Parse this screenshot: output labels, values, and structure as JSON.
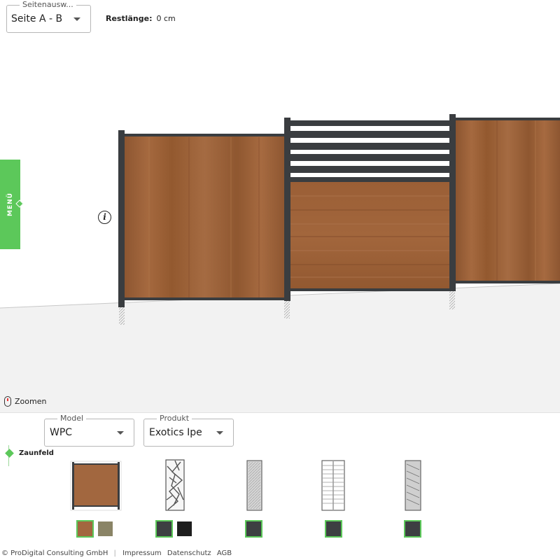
{
  "top": {
    "side_select": {
      "legend": "Seitenausw...",
      "value": "Seite A - B"
    },
    "rest_label": "Restlänge:",
    "rest_value": "0 cm"
  },
  "side_menu": {
    "label": "MENÜ"
  },
  "zoom_label": "Zoomen",
  "panel": {
    "model_select": {
      "legend": "Model",
      "value": "WPC"
    },
    "product_select": {
      "legend": "Produkt",
      "value": "Exotics Ipe"
    },
    "section_label": "Zaunfeld",
    "thumbnails": [
      {
        "name": "wpc-solid",
        "swatches": [
          "#a2673f",
          "#8a8466"
        ]
      },
      {
        "name": "decor-branches",
        "swatches": [
          "#3d3f42",
          "#1e1e1e"
        ]
      },
      {
        "name": "decor-stone",
        "swatches": [
          "#3d3f42"
        ]
      },
      {
        "name": "decor-lines",
        "swatches": [
          "#3d3f42"
        ]
      },
      {
        "name": "decor-texture",
        "swatches": [
          "#3d3f42"
        ]
      }
    ]
  },
  "footer": {
    "copyright": "© ProDigital Consulting GmbH",
    "links": [
      "Impressum",
      "Datenschutz",
      "AGB"
    ]
  },
  "colors": {
    "accent": "#5cc85a",
    "post": "#3a3d40",
    "wood": "#9a5f36"
  }
}
